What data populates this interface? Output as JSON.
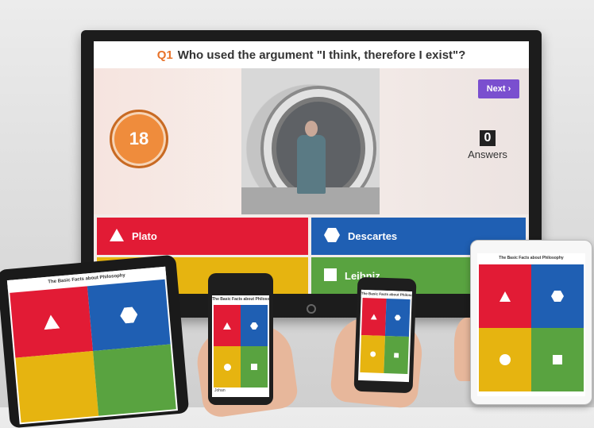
{
  "quiz": {
    "question_number": "Q1",
    "question_text": "Who used the argument \"I think, therefore I exist\"?",
    "timer_value": "18",
    "next_label": "Next ›",
    "answers_count": "0",
    "answers_label": "Answers",
    "options": [
      {
        "label": "Plato",
        "shape": "triangle-icon",
        "color": "#e21b35"
      },
      {
        "label": "Descartes",
        "shape": "hexagon-icon",
        "color": "#1f5fb3"
      },
      {
        "label": "",
        "shape": "circle-icon",
        "color": "#e6b410"
      },
      {
        "label": "Leibniz",
        "shape": "square-icon",
        "color": "#59a340"
      }
    ]
  },
  "devices": {
    "left_tablet_title": "The Basic Facts about Philosophy",
    "phone_1_title": "The Basic Facts about Philoso...",
    "phone_1_user": "Johan",
    "phone_2_title": "The Basic Facts about Philoso...",
    "right_tablet_title": "The Basic Facts about Philosophy"
  },
  "colors": {
    "accent_orange": "#e8732a",
    "next_purple": "#7a4fcf",
    "red": "#e21b35",
    "blue": "#1f5fb3",
    "yellow": "#e6b410",
    "green": "#59a340"
  }
}
